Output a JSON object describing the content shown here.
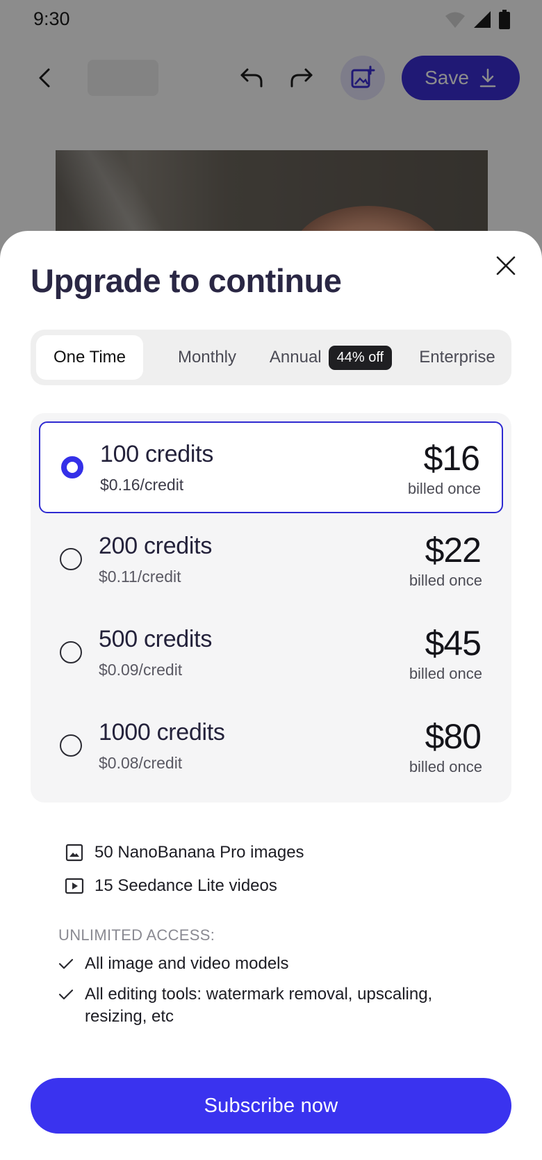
{
  "status_bar": {
    "time": "9:30"
  },
  "editor": {
    "save_label": "Save"
  },
  "sheet": {
    "title": "Upgrade to continue",
    "tabs": [
      {
        "label": "One Time",
        "active": true
      },
      {
        "label": "Monthly",
        "active": false
      },
      {
        "label": "Annual",
        "badge": "44% off",
        "active": false
      },
      {
        "label": "Enterprise",
        "active": false
      }
    ],
    "plans": [
      {
        "credits": "100 credits",
        "rate": "$0.16/credit",
        "price": "$16",
        "billing": "billed once",
        "selected": true
      },
      {
        "credits": "200 credits",
        "rate": "$0.11/credit",
        "price": "$22",
        "billing": "billed once",
        "selected": false
      },
      {
        "credits": "500 credits",
        "rate": "$0.09/credit",
        "price": "$45",
        "billing": "billed once",
        "selected": false
      },
      {
        "credits": "1000 credits",
        "rate": "$0.08/credit",
        "price": "$80",
        "billing": "billed once",
        "selected": false
      }
    ],
    "features": [
      {
        "icon": "image-icon",
        "text": "50 NanoBanana Pro images"
      },
      {
        "icon": "video-icon",
        "text": "15 Seedance Lite videos"
      }
    ],
    "unlimited_heading": "UNLIMITED ACCESS:",
    "unlimited_items": [
      "All image and video models",
      "All editing tools: watermark removal, upscaling, resizing, etc"
    ],
    "cta_label": "Subscribe now"
  },
  "colors": {
    "accent": "#3a33ef",
    "selected_border": "#2e2ad1",
    "save_button": "#3b2fd6",
    "badge_bg": "#1f1f22"
  }
}
